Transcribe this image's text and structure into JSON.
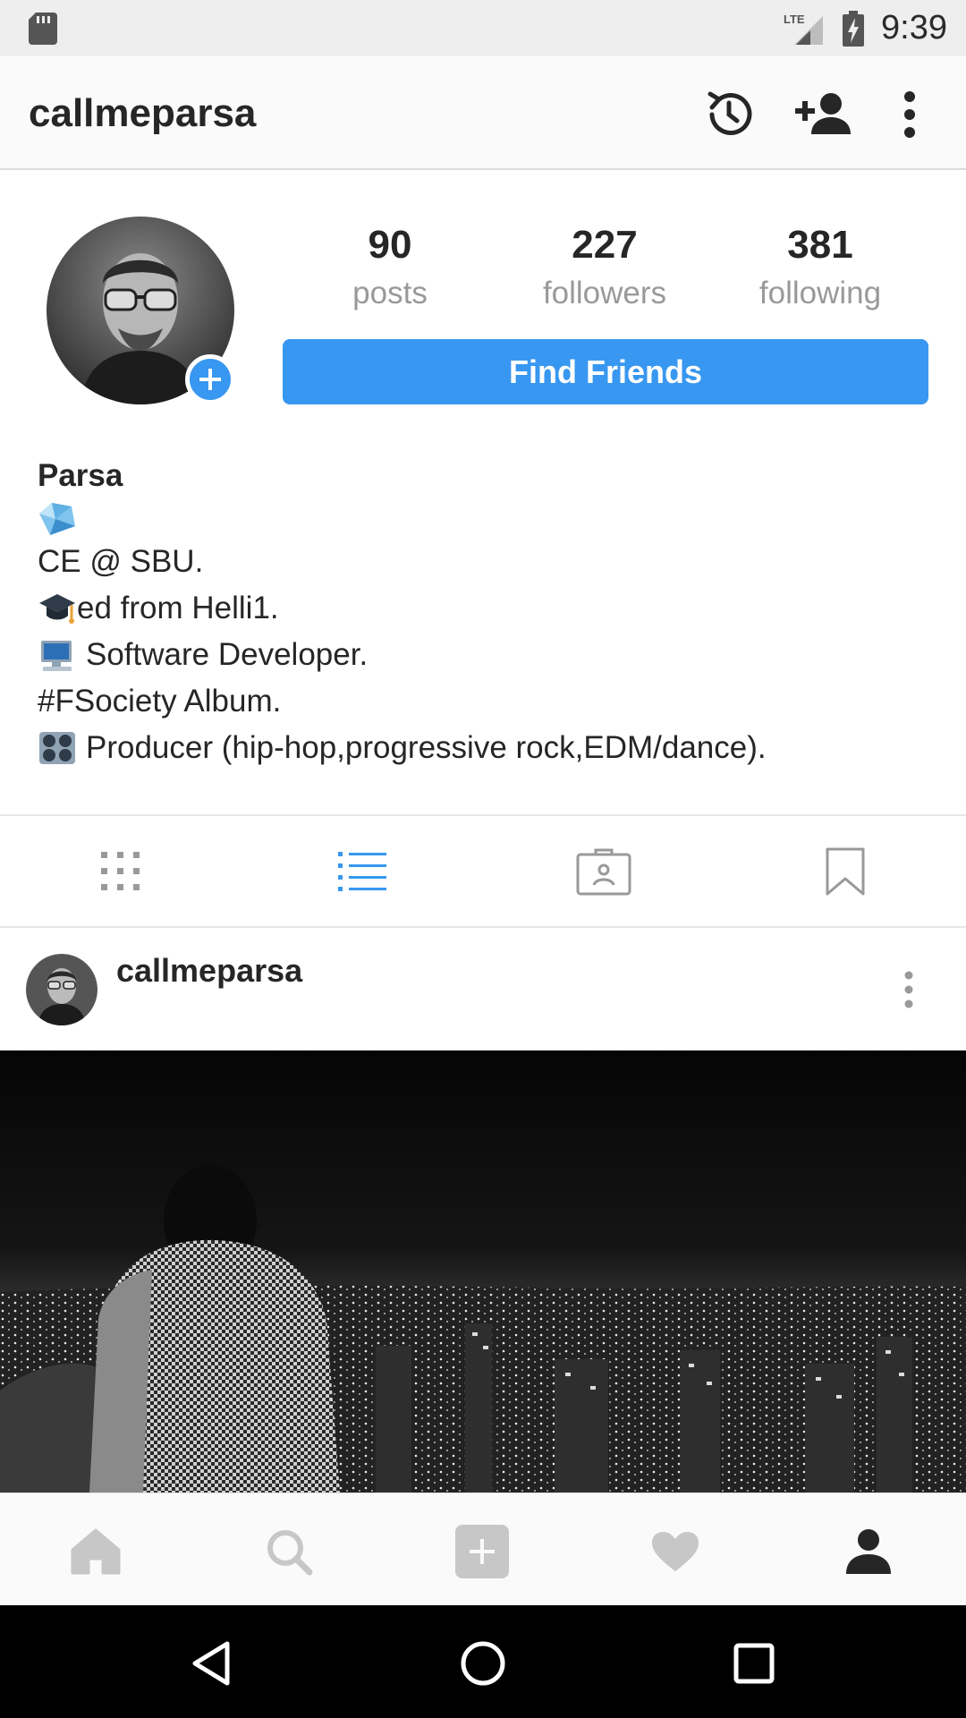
{
  "status_bar": {
    "network": "LTE",
    "time": "9:39"
  },
  "header": {
    "username": "callmeparsa",
    "icons": [
      "history-icon",
      "add-person-icon",
      "more-vertical-icon"
    ]
  },
  "profile": {
    "stats": [
      {
        "value": "90",
        "label": "posts"
      },
      {
        "value": "227",
        "label": "followers"
      },
      {
        "value": "381",
        "label": "following"
      }
    ],
    "find_friends_label": "Find Friends",
    "accent_color": "#3897f0"
  },
  "bio": {
    "name": "Parsa",
    "lines": [
      {
        "emoji": "diamond-emoji",
        "text": ""
      },
      {
        "emoji": "",
        "text": "CE @ SBU."
      },
      {
        "emoji": "graduation-cap-emoji",
        "text": "ed from Helli1."
      },
      {
        "emoji": "computer-emoji",
        "text": " Software Developer."
      },
      {
        "emoji": "",
        "text": "#FSociety Album."
      },
      {
        "emoji": "control-knobs-emoji",
        "text": " Producer (hip-hop,progressive rock,EDM/dance)."
      }
    ]
  },
  "tabs": [
    {
      "name": "grid-icon",
      "active": false
    },
    {
      "name": "list-icon",
      "active": true
    },
    {
      "name": "tagged-icon",
      "active": false
    },
    {
      "name": "saved-icon",
      "active": false
    }
  ],
  "post": {
    "username": "callmeparsa"
  },
  "bottom_nav": [
    "home-icon",
    "search-icon",
    "new-post-icon",
    "activity-heart-icon",
    "profile-icon"
  ],
  "system_nav": [
    "back-icon",
    "home-circle-icon",
    "recents-icon"
  ]
}
